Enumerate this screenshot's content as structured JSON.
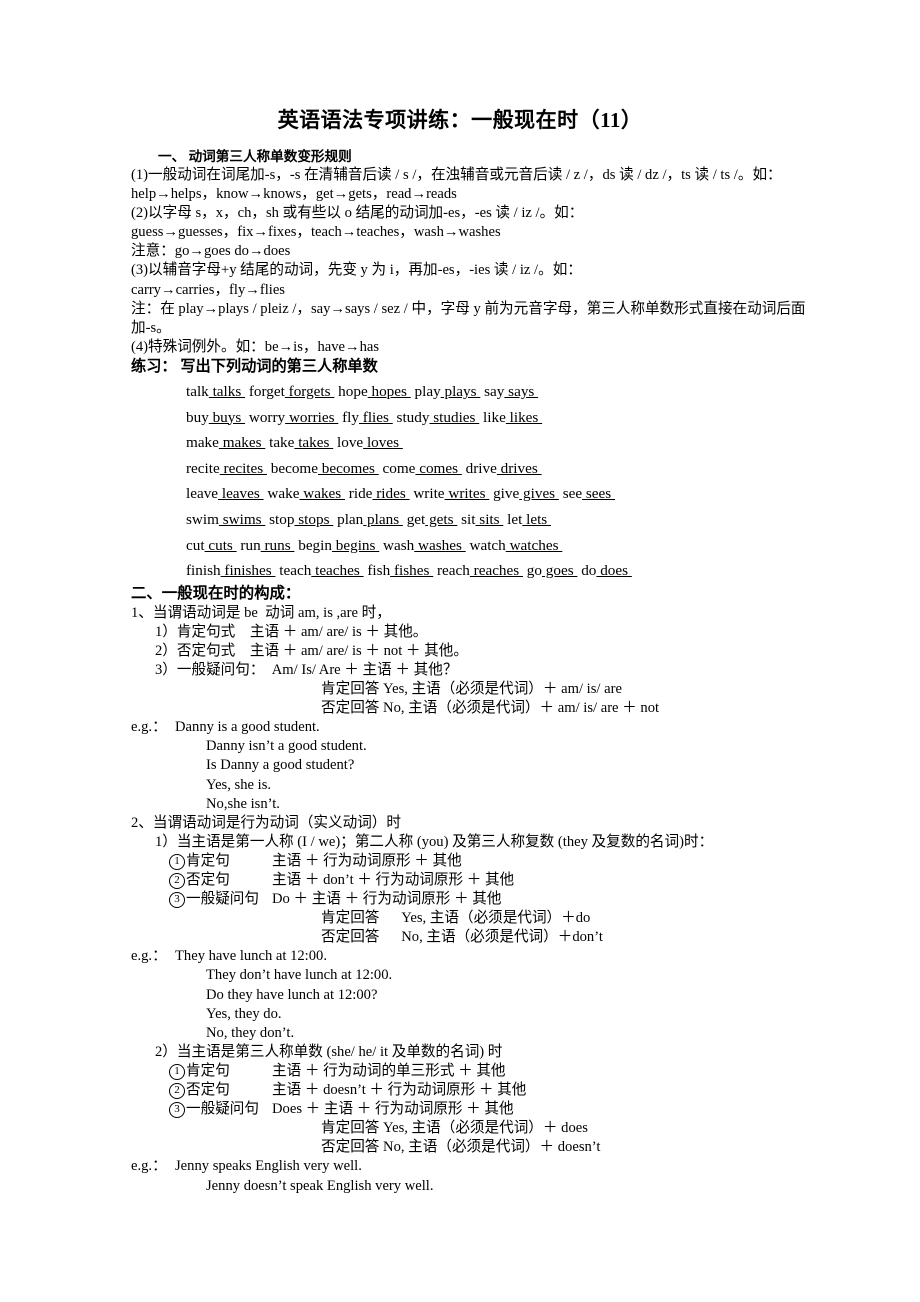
{
  "document": {
    "title": "英语语法专项讲练：一般现在时（11）",
    "section1": {
      "heading": "一、 动词第三人称单数变形规则",
      "rules": [
        "(1)一般动词在词尾加-s，-s 在清辅音后读 / s /，在浊辅音或元音后读 / z /，ds 读 / dz /，ts 读 / ts /。如：",
        "help→helps，know→knows，get→gets，read→reads",
        "(2)以字母 s，x，ch，sh 或有些以 o 结尾的动词加-es，-es 读 / iz /。如：",
        "guess→guesses，fix→fixes，teach→teaches，wash→washes",
        "注意：go→goes do→does",
        "(3)以辅音字母+y 结尾的动词，先变 y 为 i，再加-es，-ies 读 / iz /。如：",
        "carry→carries，fly→flies",
        "注：在 play→plays / pleiz /，say→says / sez / 中，字母 y 前为元音字母，第三人称单数形式直接在动词后面加-s。",
        "(4)特殊词例外。如：be→is，have→has"
      ],
      "practice_heading": "练习： 写出下列动词的第三人称单数",
      "exercise_rows": [
        [
          {
            "base": "talk",
            "answer": "talks"
          },
          {
            "base": "forget",
            "answer": "forgets"
          },
          {
            "base": "hope",
            "answer": "hopes"
          },
          {
            "base": "play",
            "answer": "plays"
          },
          {
            "base": "say",
            "answer": "says"
          }
        ],
        [
          {
            "base": "buy",
            "answer": "buys"
          },
          {
            "base": "worry",
            "answer": "worries"
          },
          {
            "base": "fly",
            "answer": "flies"
          },
          {
            "base": "study",
            "answer": "studies"
          },
          {
            "base": "like",
            "answer": "likes"
          }
        ],
        [
          {
            "base": "make",
            "answer": "makes"
          },
          {
            "base": "take",
            "answer": "takes"
          },
          {
            "base": "love",
            "answer": "loves"
          }
        ],
        [
          {
            "base": "recite",
            "answer": "recites"
          },
          {
            "base": "become",
            "answer": "becomes"
          },
          {
            "base": "come",
            "answer": "comes"
          },
          {
            "base": "drive",
            "answer": "drives"
          }
        ],
        [
          {
            "base": "leave",
            "answer": "leaves"
          },
          {
            "base": "wake",
            "answer": "wakes"
          },
          {
            "base": "ride",
            "answer": "rides"
          },
          {
            "base": "write",
            "answer": "writes"
          },
          {
            "base": "give",
            "answer": "gives"
          },
          {
            "base": "see",
            "answer": "sees"
          }
        ],
        [
          {
            "base": "swim",
            "answer": "swims"
          },
          {
            "base": "stop",
            "answer": "stops"
          },
          {
            "base": "plan",
            "answer": "plans"
          },
          {
            "base": "get",
            "answer": "gets"
          },
          {
            "base": "sit",
            "answer": "sits"
          },
          {
            "base": "let",
            "answer": "lets"
          }
        ],
        [
          {
            "base": "cut",
            "answer": "cuts"
          },
          {
            "base": "run",
            "answer": "runs"
          },
          {
            "base": "begin",
            "answer": "begins"
          },
          {
            "base": "wash",
            "answer": "washes"
          },
          {
            "base": "watch",
            "answer": "watches"
          }
        ],
        [
          {
            "base": "finish",
            "answer": "finishes"
          },
          {
            "base": "teach",
            "answer": "teaches"
          },
          {
            "base": "fish",
            "answer": "fishes"
          },
          {
            "base": "reach",
            "answer": "reaches"
          },
          {
            "base": "go",
            "answer": "goes"
          },
          {
            "base": "do",
            "answer": "does"
          }
        ]
      ]
    },
    "section2": {
      "heading": "二、一般现在时的构成：",
      "item1": {
        "label": "1、当谓语动词是 be  动词 am, is ,are 时，",
        "forms": [
          "1）肯定句式    主语 ＋ am/ are/ is ＋ 其他。",
          "2）否定句式    主语 ＋ am/ are/ is ＋ not ＋ 其他。",
          "3）一般疑问句：  Am/ Is/ Are ＋ 主语 ＋ 其他？"
        ],
        "answers": [
          "肯定回答 Yes, 主语（必须是代词）＋ am/ is/ are",
          "否定回答 No, 主语（必须是代词）＋ am/ is/ are ＋ not"
        ],
        "eg_label": "e.g.：",
        "examples": [
          "Danny is a good student.",
          "Danny isn’t a good student.",
          "Is Danny a good student?",
          "Yes, she is.",
          "No,she isn’t."
        ]
      },
      "item2": {
        "label": "2、当谓语动词是行为动词（实义动词）时",
        "sub1": {
          "label": "1）当主语是第一人称 (I / we)；第二人称 (you) 及第三人称复数 (they 及复数的名词)时：",
          "forms": [
            {
              "num": "①",
              "name": "肯定句",
              "rule": "主语 ＋ 行为动词原形 ＋ 其他"
            },
            {
              "num": "②",
              "name": "否定句",
              "rule": "主语 ＋ don’t ＋ 行为动词原形 ＋ 其他"
            },
            {
              "num": "③",
              "name": "一般疑问句",
              "rule": "Do ＋ 主语 ＋ 行为动词原形 ＋ 其他"
            }
          ],
          "answers": [
            "肯定回答　  Yes, 主语（必须是代词）＋do",
            "否定回答　  No, 主语（必须是代词）＋don’t"
          ],
          "eg_label": "e.g.：",
          "examples": [
            "They have lunch at 12:00.",
            "They don’t have lunch at 12:00.",
            "Do they have lunch at 12:00?",
            "Yes, they do.",
            "No, they don’t."
          ]
        },
        "sub2": {
          "label": "2）当主语是第三人称单数 (she/ he/ it 及单数的名词) 时",
          "forms": [
            {
              "num": "①",
              "name": "肯定句",
              "rule": "主语 ＋ 行为动词的单三形式 ＋ 其他"
            },
            {
              "num": "②",
              "name": "否定句",
              "rule": "主语 ＋ doesn’t ＋ 行为动词原形 ＋ 其他"
            },
            {
              "num": "③",
              "name": "一般疑问句",
              "rule": "Does ＋ 主语 ＋ 行为动词原形 ＋ 其他"
            }
          ],
          "answers": [
            "肯定回答 Yes, 主语（必须是代词）＋ does",
            "否定回答 No, 主语（必须是代词）＋ doesn’t"
          ],
          "eg_label": "e.g.：",
          "examples": [
            "Jenny speaks English very well.",
            "Jenny doesn’t speak English very well."
          ]
        }
      }
    }
  }
}
